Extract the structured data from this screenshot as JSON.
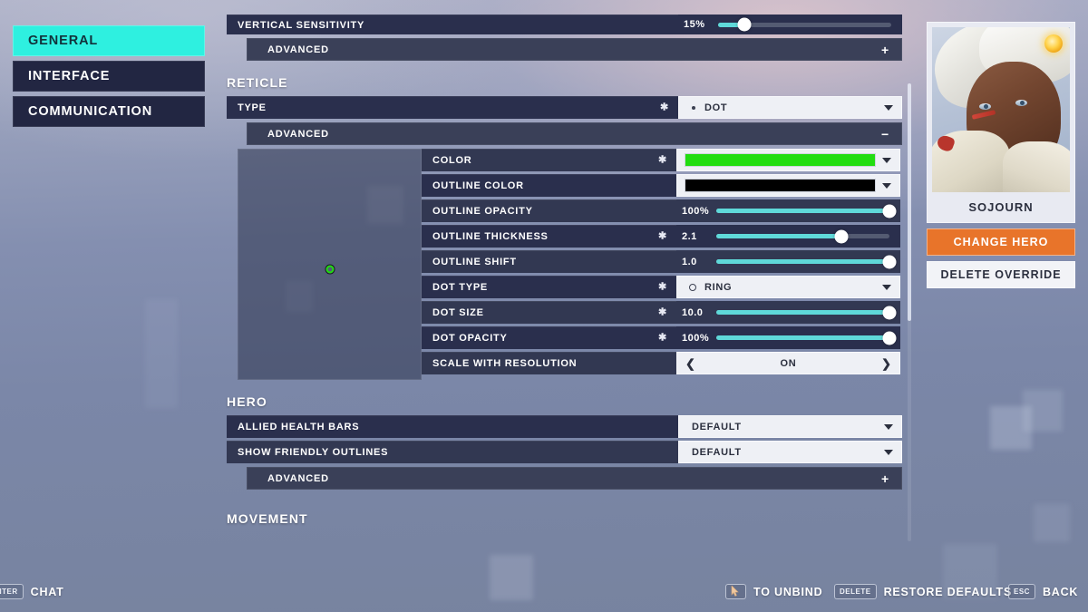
{
  "nav": {
    "items": [
      {
        "label": "GENERAL",
        "active": true
      },
      {
        "label": "INTERFACE",
        "active": false
      },
      {
        "label": "COMMUNICATION",
        "active": false
      }
    ]
  },
  "settings": {
    "top_partial_row": {
      "label": "VERTICAL SENSITIVITY",
      "value": "15%",
      "fill_percent": 15
    },
    "top_advanced": {
      "label": "ADVANCED",
      "state": "+"
    },
    "sections": [
      {
        "title": "RETICLE",
        "type_row": {
          "label": "TYPE",
          "value": "DOT",
          "overridden": true,
          "glyph": "dot"
        },
        "advanced": {
          "label": "ADVANCED",
          "state": "−"
        },
        "rows": [
          {
            "label": "COLOR",
            "kind": "color",
            "swatch": "#22dd11",
            "overridden": true
          },
          {
            "label": "OUTLINE COLOR",
            "kind": "color",
            "swatch": "#000000",
            "overridden": false
          },
          {
            "label": "OUTLINE OPACITY",
            "kind": "slider",
            "value": "100%",
            "fill_percent": 100,
            "overridden": false
          },
          {
            "label": "OUTLINE THICKNESS",
            "kind": "slider",
            "value": "2.1",
            "fill_percent": 72,
            "overridden": true
          },
          {
            "label": "OUTLINE SHIFT",
            "kind": "slider",
            "value": "1.0",
            "fill_percent": 100,
            "overridden": false
          },
          {
            "label": "DOT TYPE",
            "kind": "select",
            "value": "RING",
            "glyph": "ring",
            "overridden": true
          },
          {
            "label": "DOT SIZE",
            "kind": "slider",
            "value": "10.0",
            "fill_percent": 100,
            "overridden": true
          },
          {
            "label": "DOT OPACITY",
            "kind": "slider",
            "value": "100%",
            "fill_percent": 100,
            "overridden": true
          },
          {
            "label": "SCALE WITH RESOLUTION",
            "kind": "stepper",
            "value": "ON",
            "overridden": false
          }
        ]
      },
      {
        "title": "HERO",
        "rows": [
          {
            "label": "ALLIED HEALTH BARS",
            "kind": "select",
            "value": "DEFAULT",
            "overridden": false
          },
          {
            "label": "SHOW FRIENDLY OUTLINES",
            "kind": "select",
            "value": "DEFAULT",
            "overridden": false
          }
        ],
        "advanced": {
          "label": "ADVANCED",
          "state": "+"
        }
      },
      {
        "title": "MOVEMENT"
      }
    ]
  },
  "hero_panel": {
    "name": "SOJOURN",
    "change_button": "CHANGE HERO",
    "delete_button": "DELETE OVERRIDE"
  },
  "bottom_bar": {
    "left": [
      {
        "key": "ENTER",
        "label": "CHAT"
      }
    ],
    "right": [
      {
        "key": "cursor-icon",
        "label": "TO UNBIND"
      },
      {
        "key": "DELETE",
        "label": "RESTORE DEFAULTS"
      },
      {
        "key": "ESC",
        "label": "BACK"
      }
    ]
  },
  "colors": {
    "accent_cyan": "#2ef0e0",
    "slider_fill": "#5fd9d9",
    "orange_button": "#e8742a",
    "reticle_green": "#22dd11",
    "panel_dark": "#2a2f4d"
  }
}
